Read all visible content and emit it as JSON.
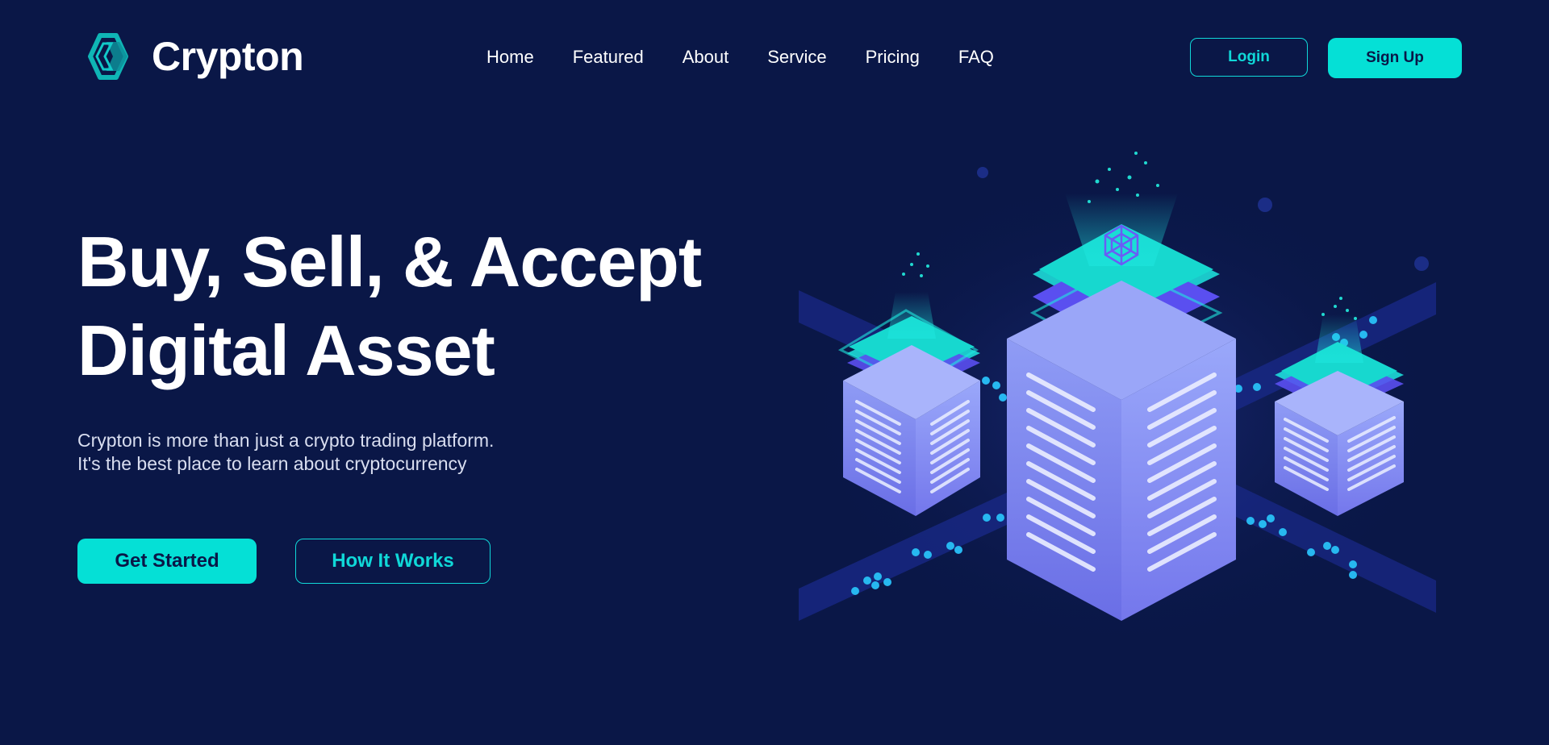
{
  "header": {
    "logo_text": "Crypton",
    "nav": [
      {
        "label": "Home"
      },
      {
        "label": "Featured"
      },
      {
        "label": "About"
      },
      {
        "label": "Service"
      },
      {
        "label": "Pricing"
      },
      {
        "label": "FAQ"
      }
    ],
    "login_label": "Login",
    "signup_label": "Sign Up"
  },
  "hero": {
    "title_line1": "Buy, Sell, & Accept",
    "title_line2": "Digital Asset",
    "desc_line1": "Crypton is more than just a crypto trading platform.",
    "desc_line2": "It's the best place to learn about cryptocurrency",
    "get_started_label": "Get Started",
    "how_it_works_label": "How It Works"
  },
  "illustration": {
    "icon": "isometric-server-towers-illustration"
  },
  "colors": {
    "background": "#0a1747",
    "accent": "#05e0d6",
    "text": "#ffffff",
    "muted_text": "#d9def0"
  }
}
